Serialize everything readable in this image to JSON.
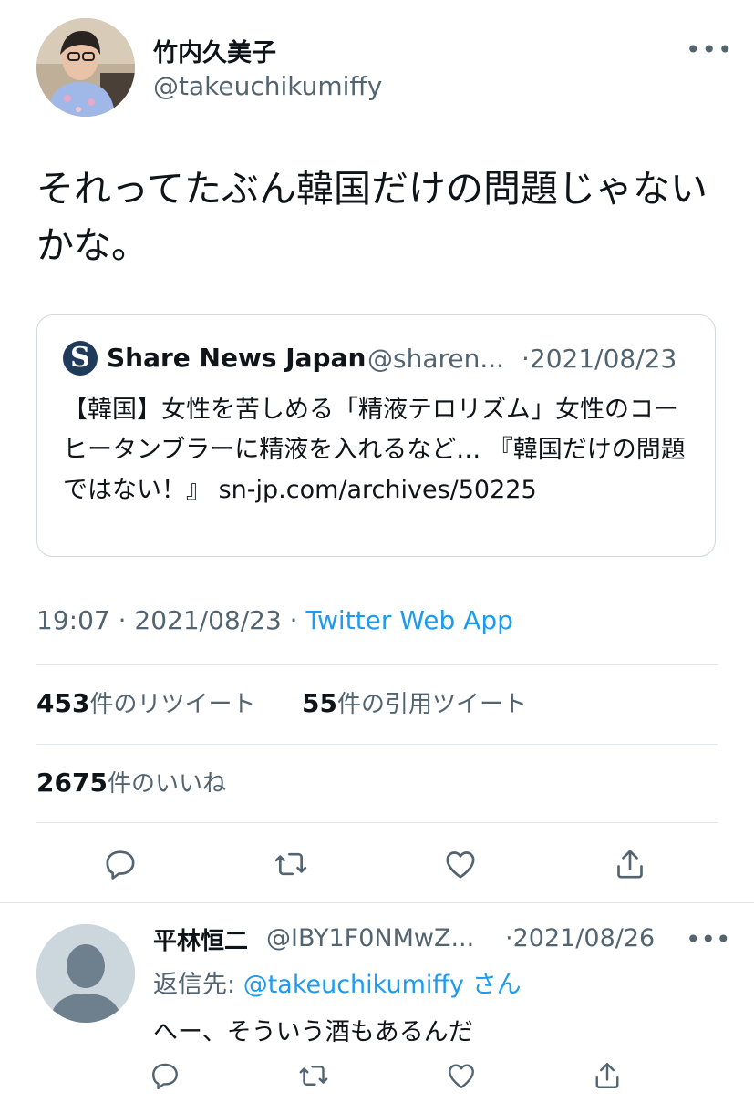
{
  "tweet": {
    "author_name": "竹内久美子",
    "author_handle": "@takeuchikumiffy",
    "more_label": "•••",
    "text": "それってたぶん韓国だけの問題じゃないかな。",
    "quote": {
      "logo_letter": "S",
      "name": "Share News Japan",
      "handle": "@sharen...",
      "date": "·2021/08/23",
      "text": "【韓国】女性を苦しめる「精液テロリズム」女性のコーヒータンブラーに精液を入れるなど… 『韓国だけの問題ではない！』 sn-jp.com/archives/50225"
    },
    "time": "19:07 · 2021/08/23 · ",
    "source": "Twitter Web App",
    "stats": {
      "retweets_count": "453",
      "retweets_label": "件のリツイート",
      "quotes_count": "55",
      "quotes_label": "件の引用ツイート",
      "likes_count": "2675",
      "likes_label": "件のいいね"
    },
    "icons": [
      "reply-icon",
      "retweet-icon",
      "like-icon",
      "share-icon"
    ]
  },
  "reply": {
    "author_name": "平林恒二",
    "author_handle": "@IBY1F0NMwZ...",
    "date": "·2021/08/26",
    "more_label": "•••",
    "reply_prefix": "返信先: ",
    "reply_to_handle": "@takeuchikumiffy",
    "reply_suffix": " さん",
    "text": "へー、そういう酒もあるんだ"
  },
  "colors": {
    "link": "#1d9bf0",
    "muted": "#536471",
    "text": "#0f1419",
    "divider": "#e1e8ed"
  }
}
